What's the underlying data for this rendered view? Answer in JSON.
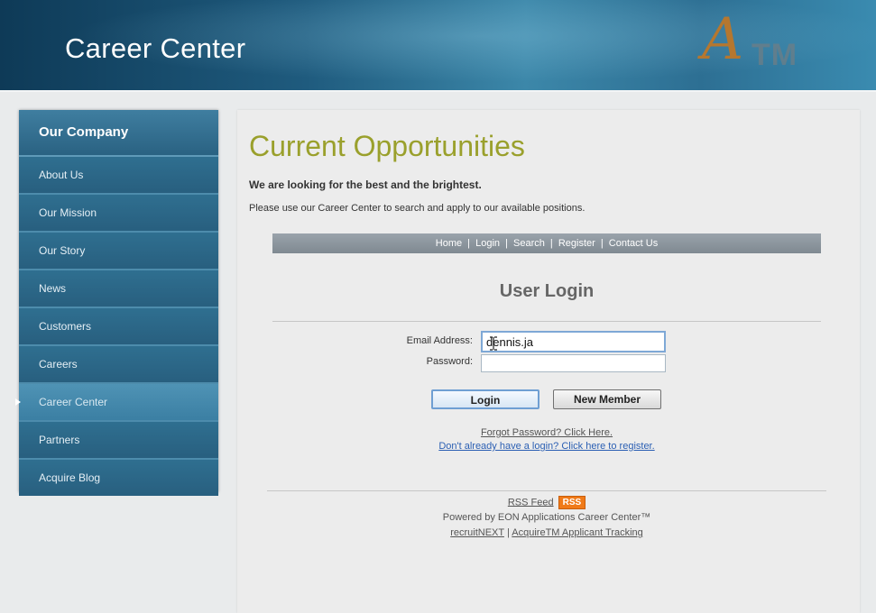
{
  "header": {
    "title": "Career Center",
    "logo_letter": "A",
    "logo_suffix": "TM"
  },
  "sidebar": {
    "title": "Our Company",
    "items": [
      {
        "label": "About Us"
      },
      {
        "label": "Our Mission"
      },
      {
        "label": "Our Story"
      },
      {
        "label": "News"
      },
      {
        "label": "Customers"
      },
      {
        "label": "Careers"
      },
      {
        "label": "Career Center",
        "active": true
      },
      {
        "label": "Partners"
      },
      {
        "label": "Acquire Blog"
      }
    ]
  },
  "main": {
    "title": "Current Opportunities",
    "lead": "We are looking for the best and the brightest.",
    "description": "Please use our Career Center to search and apply to our available positions.",
    "nav": [
      "Home",
      "Login",
      "Search",
      "Register",
      "Contact Us"
    ],
    "nav_separator": "|",
    "login": {
      "heading": "User Login",
      "email_label": "Email Address:",
      "email_value": "dennis.ja",
      "password_label": "Password:",
      "password_value": "",
      "login_button": "Login",
      "new_member_button": "New Member",
      "forgot_link": "Forgot Password? Click Here.",
      "register_link": "Don't already have a login? Click here to register."
    },
    "footer": {
      "rss_feed": "RSS Feed",
      "rss_badge": "RSS",
      "powered_by": "Powered by EON Applications Career Center™",
      "recruit_link": "recruitNEXT",
      "separator": "|",
      "tracking_link": "AcquireTM Applicant Tracking"
    }
  },
  "colors": {
    "header_dark": "#0e3a57",
    "header_light": "#3c87a9",
    "sidebar": "#2b6787",
    "title_olive": "#9aa02c",
    "rss_orange": "#f07a18"
  }
}
